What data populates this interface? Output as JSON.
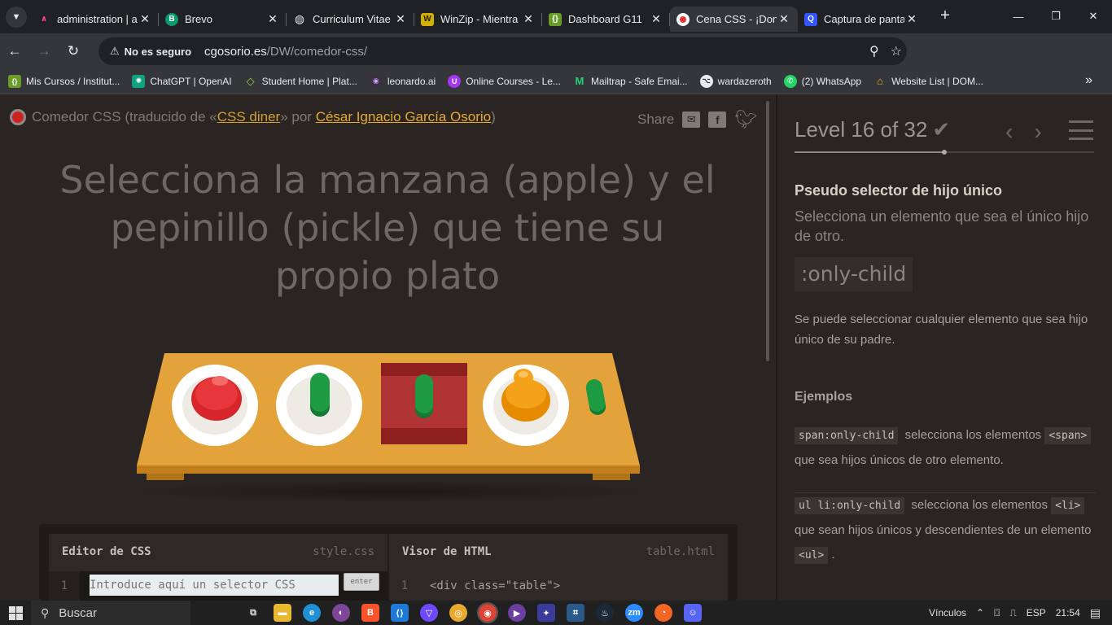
{
  "browser": {
    "tabs": [
      {
        "title": "administration | a",
        "icon": "admin-icon",
        "color": "#ff4a8a"
      },
      {
        "title": "Brevo",
        "icon": "brevo-icon",
        "color": "#0b996e"
      },
      {
        "title": "Curriculum Vitae",
        "icon": "globe-icon",
        "color": "#5f6368"
      },
      {
        "title": "WinZip - Mientra",
        "icon": "winzip-icon",
        "color": "#d4b000"
      },
      {
        "title": "Dashboard G11",
        "icon": "dashboard-icon",
        "color": "#6a9c2a"
      },
      {
        "title": "Cena CSS - ¡Don",
        "icon": "cena-icon",
        "color": "#e53935",
        "active": true
      },
      {
        "title": "Captura de panta",
        "icon": "capture-icon",
        "color": "#3355ff"
      }
    ],
    "security_label": "No es seguro",
    "url_host": "cgosorio.es",
    "url_path": "/DW/comedor-css/",
    "bookmarks": [
      {
        "label": "Mis Cursos / Institut...",
        "icon": "cursos-icon",
        "color": "#6a9c2a"
      },
      {
        "label": "ChatGPT | OpenAI",
        "icon": "chatgpt-icon",
        "color": "#10a37f"
      },
      {
        "label": "Student Home | Plat...",
        "icon": "platzi-icon",
        "color": "#98ca3f"
      },
      {
        "label": "leonardo.ai",
        "icon": "leonardo-icon",
        "color": "#8a6cff"
      },
      {
        "label": "Online Courses - Le...",
        "icon": "udemy-icon",
        "color": "#a435f0"
      },
      {
        "label": "Mailtrap - Safe Emai...",
        "icon": "mailtrap-icon",
        "color": "#22d172"
      },
      {
        "label": "wardazeroth",
        "icon": "github-icon",
        "color": "#ffffff"
      },
      {
        "label": "(2) WhatsApp",
        "icon": "whatsapp-icon",
        "color": "#25d366"
      },
      {
        "label": "Website List | DOM...",
        "icon": "website-icon",
        "color": "#e8a92f"
      }
    ]
  },
  "game": {
    "header_prefix": "Comedor CSS (traducido de «",
    "header_link": "CSS diner",
    "header_mid": "» por ",
    "header_author": "César Ignacio García Osorio",
    "header_suffix": ")",
    "share_label": "Share",
    "order": "Selecciona la manzana (apple) y el pepinillo (pickle) que tiene su propio plato",
    "css_editor_title": "Editor de CSS",
    "css_editor_file": "style.css",
    "html_viewer_title": "Visor de HTML",
    "html_viewer_file": "table.html",
    "line_number": "1",
    "css_placeholder": "Introduce aquí un selector CSS",
    "enter_label": "enter",
    "html_line": "<div class=\"table\">"
  },
  "level": {
    "label": "Level 16 of 32",
    "progress": 0.5,
    "selector_name": "Pseudo selector de hijo único",
    "title": "Selecciona un elemento que sea el único hijo de otro.",
    "syntax": ":only-child",
    "hint": "Se puede seleccionar cualquier elemento que sea hijo único de su padre.",
    "examples_title": "Ejemplos",
    "ex1_code": "span:only-child",
    "ex1_text1": " selecciona los elementos ",
    "ex1_code2": "<span>",
    "ex1_text2": " que sea hijos únicos de otro elemento.",
    "ex2_code": "ul li:only-child",
    "ex2_text1": " selecciona los elementos ",
    "ex2_code2": "<li>",
    "ex2_text2": " que sean hijos únicos y descendientes de un elemento ",
    "ex2_code3": "<ul>",
    "ex2_text3": "."
  },
  "taskbar": {
    "search_label": "Buscar",
    "vinculos": "Vínculos",
    "lang": "ESP",
    "time": "21:54"
  }
}
